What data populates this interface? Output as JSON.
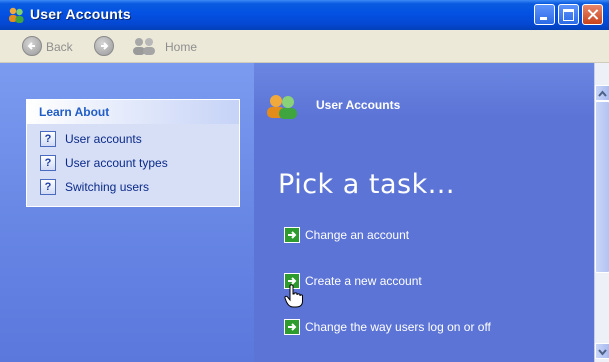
{
  "window": {
    "title": "User Accounts"
  },
  "toolbar": {
    "back_label": "Back",
    "home_label": "Home"
  },
  "learn_about": {
    "header": "Learn About",
    "items": [
      {
        "label": "User accounts",
        "icon": "help-icon"
      },
      {
        "label": "User account types",
        "icon": "help-icon"
      },
      {
        "label": "Switching users",
        "icon": "help-icon"
      }
    ]
  },
  "main": {
    "header_title": "User Accounts",
    "heading": "Pick a task...",
    "tasks": [
      {
        "label": "Change an account",
        "icon": "green-arrow-icon"
      },
      {
        "label": "Create a new account",
        "icon": "green-arrow-icon"
      },
      {
        "label": "Change the way users log on or off",
        "icon": "green-arrow-icon"
      }
    ]
  },
  "colors": {
    "titlebar": "#0451e2",
    "pane_blue": "#5c74d6",
    "task_arrow_green": "#2e9b2e",
    "learn_header_text": "#215dc6"
  }
}
